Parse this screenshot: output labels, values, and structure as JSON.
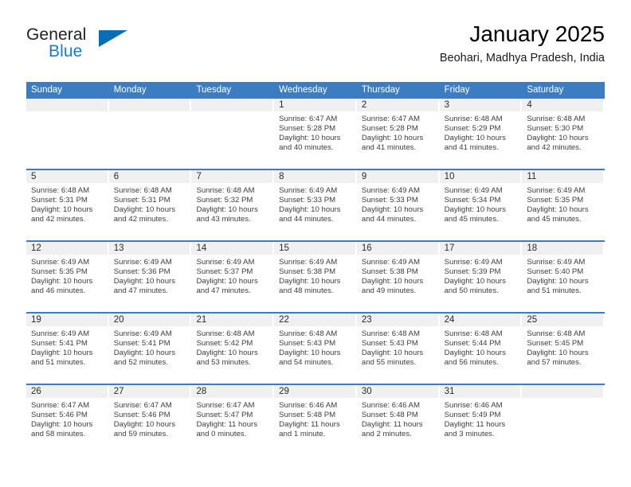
{
  "brand": {
    "name_part1": "General",
    "name_part2": "Blue",
    "triangle_color": "#0a6db5",
    "blue_color": "#1f7ac0"
  },
  "header": {
    "title": "January 2025",
    "subtitle": "Beohari, Madhya Pradesh, India"
  },
  "theme": {
    "header_blue": "#3b7dc0",
    "date_band_gray": "#f0f0f0",
    "row_separator": "#3b7dc0",
    "text": "#3d3d3d"
  },
  "weekdays": [
    {
      "label": "Sunday"
    },
    {
      "label": "Monday"
    },
    {
      "label": "Tuesday"
    },
    {
      "label": "Wednesday"
    },
    {
      "label": "Thursday"
    },
    {
      "label": "Friday"
    },
    {
      "label": "Saturday"
    }
  ],
  "weeks": [
    {
      "days": [
        {
          "number": "",
          "empty": true,
          "sunrise": "",
          "sunset": "",
          "daylight_line1": "",
          "daylight_line2": ""
        },
        {
          "number": "",
          "empty": true,
          "sunrise": "",
          "sunset": "",
          "daylight_line1": "",
          "daylight_line2": ""
        },
        {
          "number": "",
          "empty": true,
          "sunrise": "",
          "sunset": "",
          "daylight_line1": "",
          "daylight_line2": ""
        },
        {
          "number": "1",
          "empty": false,
          "sunrise": "Sunrise: 6:47 AM",
          "sunset": "Sunset: 5:28 PM",
          "daylight_line1": "Daylight: 10 hours",
          "daylight_line2": "and 40 minutes."
        },
        {
          "number": "2",
          "empty": false,
          "sunrise": "Sunrise: 6:47 AM",
          "sunset": "Sunset: 5:28 PM",
          "daylight_line1": "Daylight: 10 hours",
          "daylight_line2": "and 41 minutes."
        },
        {
          "number": "3",
          "empty": false,
          "sunrise": "Sunrise: 6:48 AM",
          "sunset": "Sunset: 5:29 PM",
          "daylight_line1": "Daylight: 10 hours",
          "daylight_line2": "and 41 minutes."
        },
        {
          "number": "4",
          "empty": false,
          "sunrise": "Sunrise: 6:48 AM",
          "sunset": "Sunset: 5:30 PM",
          "daylight_line1": "Daylight: 10 hours",
          "daylight_line2": "and 42 minutes."
        }
      ]
    },
    {
      "days": [
        {
          "number": "5",
          "empty": false,
          "sunrise": "Sunrise: 6:48 AM",
          "sunset": "Sunset: 5:31 PM",
          "daylight_line1": "Daylight: 10 hours",
          "daylight_line2": "and 42 minutes."
        },
        {
          "number": "6",
          "empty": false,
          "sunrise": "Sunrise: 6:48 AM",
          "sunset": "Sunset: 5:31 PM",
          "daylight_line1": "Daylight: 10 hours",
          "daylight_line2": "and 42 minutes."
        },
        {
          "number": "7",
          "empty": false,
          "sunrise": "Sunrise: 6:48 AM",
          "sunset": "Sunset: 5:32 PM",
          "daylight_line1": "Daylight: 10 hours",
          "daylight_line2": "and 43 minutes."
        },
        {
          "number": "8",
          "empty": false,
          "sunrise": "Sunrise: 6:49 AM",
          "sunset": "Sunset: 5:33 PM",
          "daylight_line1": "Daylight: 10 hours",
          "daylight_line2": "and 44 minutes."
        },
        {
          "number": "9",
          "empty": false,
          "sunrise": "Sunrise: 6:49 AM",
          "sunset": "Sunset: 5:33 PM",
          "daylight_line1": "Daylight: 10 hours",
          "daylight_line2": "and 44 minutes."
        },
        {
          "number": "10",
          "empty": false,
          "sunrise": "Sunrise: 6:49 AM",
          "sunset": "Sunset: 5:34 PM",
          "daylight_line1": "Daylight: 10 hours",
          "daylight_line2": "and 45 minutes."
        },
        {
          "number": "11",
          "empty": false,
          "sunrise": "Sunrise: 6:49 AM",
          "sunset": "Sunset: 5:35 PM",
          "daylight_line1": "Daylight: 10 hours",
          "daylight_line2": "and 45 minutes."
        }
      ]
    },
    {
      "days": [
        {
          "number": "12",
          "empty": false,
          "sunrise": "Sunrise: 6:49 AM",
          "sunset": "Sunset: 5:35 PM",
          "daylight_line1": "Daylight: 10 hours",
          "daylight_line2": "and 46 minutes."
        },
        {
          "number": "13",
          "empty": false,
          "sunrise": "Sunrise: 6:49 AM",
          "sunset": "Sunset: 5:36 PM",
          "daylight_line1": "Daylight: 10 hours",
          "daylight_line2": "and 47 minutes."
        },
        {
          "number": "14",
          "empty": false,
          "sunrise": "Sunrise: 6:49 AM",
          "sunset": "Sunset: 5:37 PM",
          "daylight_line1": "Daylight: 10 hours",
          "daylight_line2": "and 47 minutes."
        },
        {
          "number": "15",
          "empty": false,
          "sunrise": "Sunrise: 6:49 AM",
          "sunset": "Sunset: 5:38 PM",
          "daylight_line1": "Daylight: 10 hours",
          "daylight_line2": "and 48 minutes."
        },
        {
          "number": "16",
          "empty": false,
          "sunrise": "Sunrise: 6:49 AM",
          "sunset": "Sunset: 5:38 PM",
          "daylight_line1": "Daylight: 10 hours",
          "daylight_line2": "and 49 minutes."
        },
        {
          "number": "17",
          "empty": false,
          "sunrise": "Sunrise: 6:49 AM",
          "sunset": "Sunset: 5:39 PM",
          "daylight_line1": "Daylight: 10 hours",
          "daylight_line2": "and 50 minutes."
        },
        {
          "number": "18",
          "empty": false,
          "sunrise": "Sunrise: 6:49 AM",
          "sunset": "Sunset: 5:40 PM",
          "daylight_line1": "Daylight: 10 hours",
          "daylight_line2": "and 51 minutes."
        }
      ]
    },
    {
      "days": [
        {
          "number": "19",
          "empty": false,
          "sunrise": "Sunrise: 6:49 AM",
          "sunset": "Sunset: 5:41 PM",
          "daylight_line1": "Daylight: 10 hours",
          "daylight_line2": "and 51 minutes."
        },
        {
          "number": "20",
          "empty": false,
          "sunrise": "Sunrise: 6:49 AM",
          "sunset": "Sunset: 5:41 PM",
          "daylight_line1": "Daylight: 10 hours",
          "daylight_line2": "and 52 minutes."
        },
        {
          "number": "21",
          "empty": false,
          "sunrise": "Sunrise: 6:48 AM",
          "sunset": "Sunset: 5:42 PM",
          "daylight_line1": "Daylight: 10 hours",
          "daylight_line2": "and 53 minutes."
        },
        {
          "number": "22",
          "empty": false,
          "sunrise": "Sunrise: 6:48 AM",
          "sunset": "Sunset: 5:43 PM",
          "daylight_line1": "Daylight: 10 hours",
          "daylight_line2": "and 54 minutes."
        },
        {
          "number": "23",
          "empty": false,
          "sunrise": "Sunrise: 6:48 AM",
          "sunset": "Sunset: 5:43 PM",
          "daylight_line1": "Daylight: 10 hours",
          "daylight_line2": "and 55 minutes."
        },
        {
          "number": "24",
          "empty": false,
          "sunrise": "Sunrise: 6:48 AM",
          "sunset": "Sunset: 5:44 PM",
          "daylight_line1": "Daylight: 10 hours",
          "daylight_line2": "and 56 minutes."
        },
        {
          "number": "25",
          "empty": false,
          "sunrise": "Sunrise: 6:48 AM",
          "sunset": "Sunset: 5:45 PM",
          "daylight_line1": "Daylight: 10 hours",
          "daylight_line2": "and 57 minutes."
        }
      ]
    },
    {
      "days": [
        {
          "number": "26",
          "empty": false,
          "sunrise": "Sunrise: 6:47 AM",
          "sunset": "Sunset: 5:46 PM",
          "daylight_line1": "Daylight: 10 hours",
          "daylight_line2": "and 58 minutes."
        },
        {
          "number": "27",
          "empty": false,
          "sunrise": "Sunrise: 6:47 AM",
          "sunset": "Sunset: 5:46 PM",
          "daylight_line1": "Daylight: 10 hours",
          "daylight_line2": "and 59 minutes."
        },
        {
          "number": "28",
          "empty": false,
          "sunrise": "Sunrise: 6:47 AM",
          "sunset": "Sunset: 5:47 PM",
          "daylight_line1": "Daylight: 11 hours",
          "daylight_line2": "and 0 minutes."
        },
        {
          "number": "29",
          "empty": false,
          "sunrise": "Sunrise: 6:46 AM",
          "sunset": "Sunset: 5:48 PM",
          "daylight_line1": "Daylight: 11 hours",
          "daylight_line2": "and 1 minute."
        },
        {
          "number": "30",
          "empty": false,
          "sunrise": "Sunrise: 6:46 AM",
          "sunset": "Sunset: 5:48 PM",
          "daylight_line1": "Daylight: 11 hours",
          "daylight_line2": "and 2 minutes."
        },
        {
          "number": "31",
          "empty": false,
          "sunrise": "Sunrise: 6:46 AM",
          "sunset": "Sunset: 5:49 PM",
          "daylight_line1": "Daylight: 11 hours",
          "daylight_line2": "and 3 minutes."
        },
        {
          "number": "",
          "empty": true,
          "sunrise": "",
          "sunset": "",
          "daylight_line1": "",
          "daylight_line2": ""
        }
      ]
    }
  ]
}
